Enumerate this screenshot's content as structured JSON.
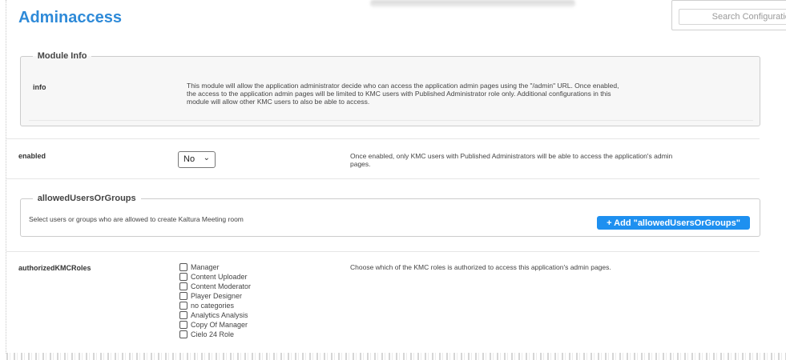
{
  "page": {
    "title": "Adminaccess",
    "search_placeholder": "Search Configuration"
  },
  "module_info": {
    "legend": "Module Info",
    "info_label": "info",
    "info_text": "This module will allow the application administrator decide who can access the application admin pages using the \"/admin\" URL. Once enabled, the access to the application admin pages will be limited to KMC users with Published Administrator role only. Additional configurations in this module will allow other KMC users to also be able to access."
  },
  "enabled": {
    "label": "enabled",
    "value": "No",
    "chevron_glyph": "⌄",
    "description": "Once enabled, only KMC users with Published Administrators will be able to access the application's admin pages."
  },
  "allowed": {
    "legend": "allowedUsersOrGroups",
    "text": "Select users or groups who are allowed to create Kaltura Meeting room",
    "add_button": "+ Add \"allowedUsersOrGroups\""
  },
  "authorized": {
    "label": "authorizedKMCRoles",
    "description": "Choose which of the KMC roles is authorized to access this application's admin pages.",
    "roles": [
      {
        "label": "Manager",
        "checked": false
      },
      {
        "label": "Content Uploader",
        "checked": false
      },
      {
        "label": "Content Moderator",
        "checked": false
      },
      {
        "label": "Player Designer",
        "checked": false
      },
      {
        "label": "no categories",
        "checked": false
      },
      {
        "label": "Analytics Analysis",
        "checked": false
      },
      {
        "label": "Copy Of Manager",
        "checked": false
      },
      {
        "label": "Cielo 24 Role",
        "checked": false
      }
    ]
  },
  "colors": {
    "title": "#2e8ad8",
    "button": "#1e90f0"
  }
}
